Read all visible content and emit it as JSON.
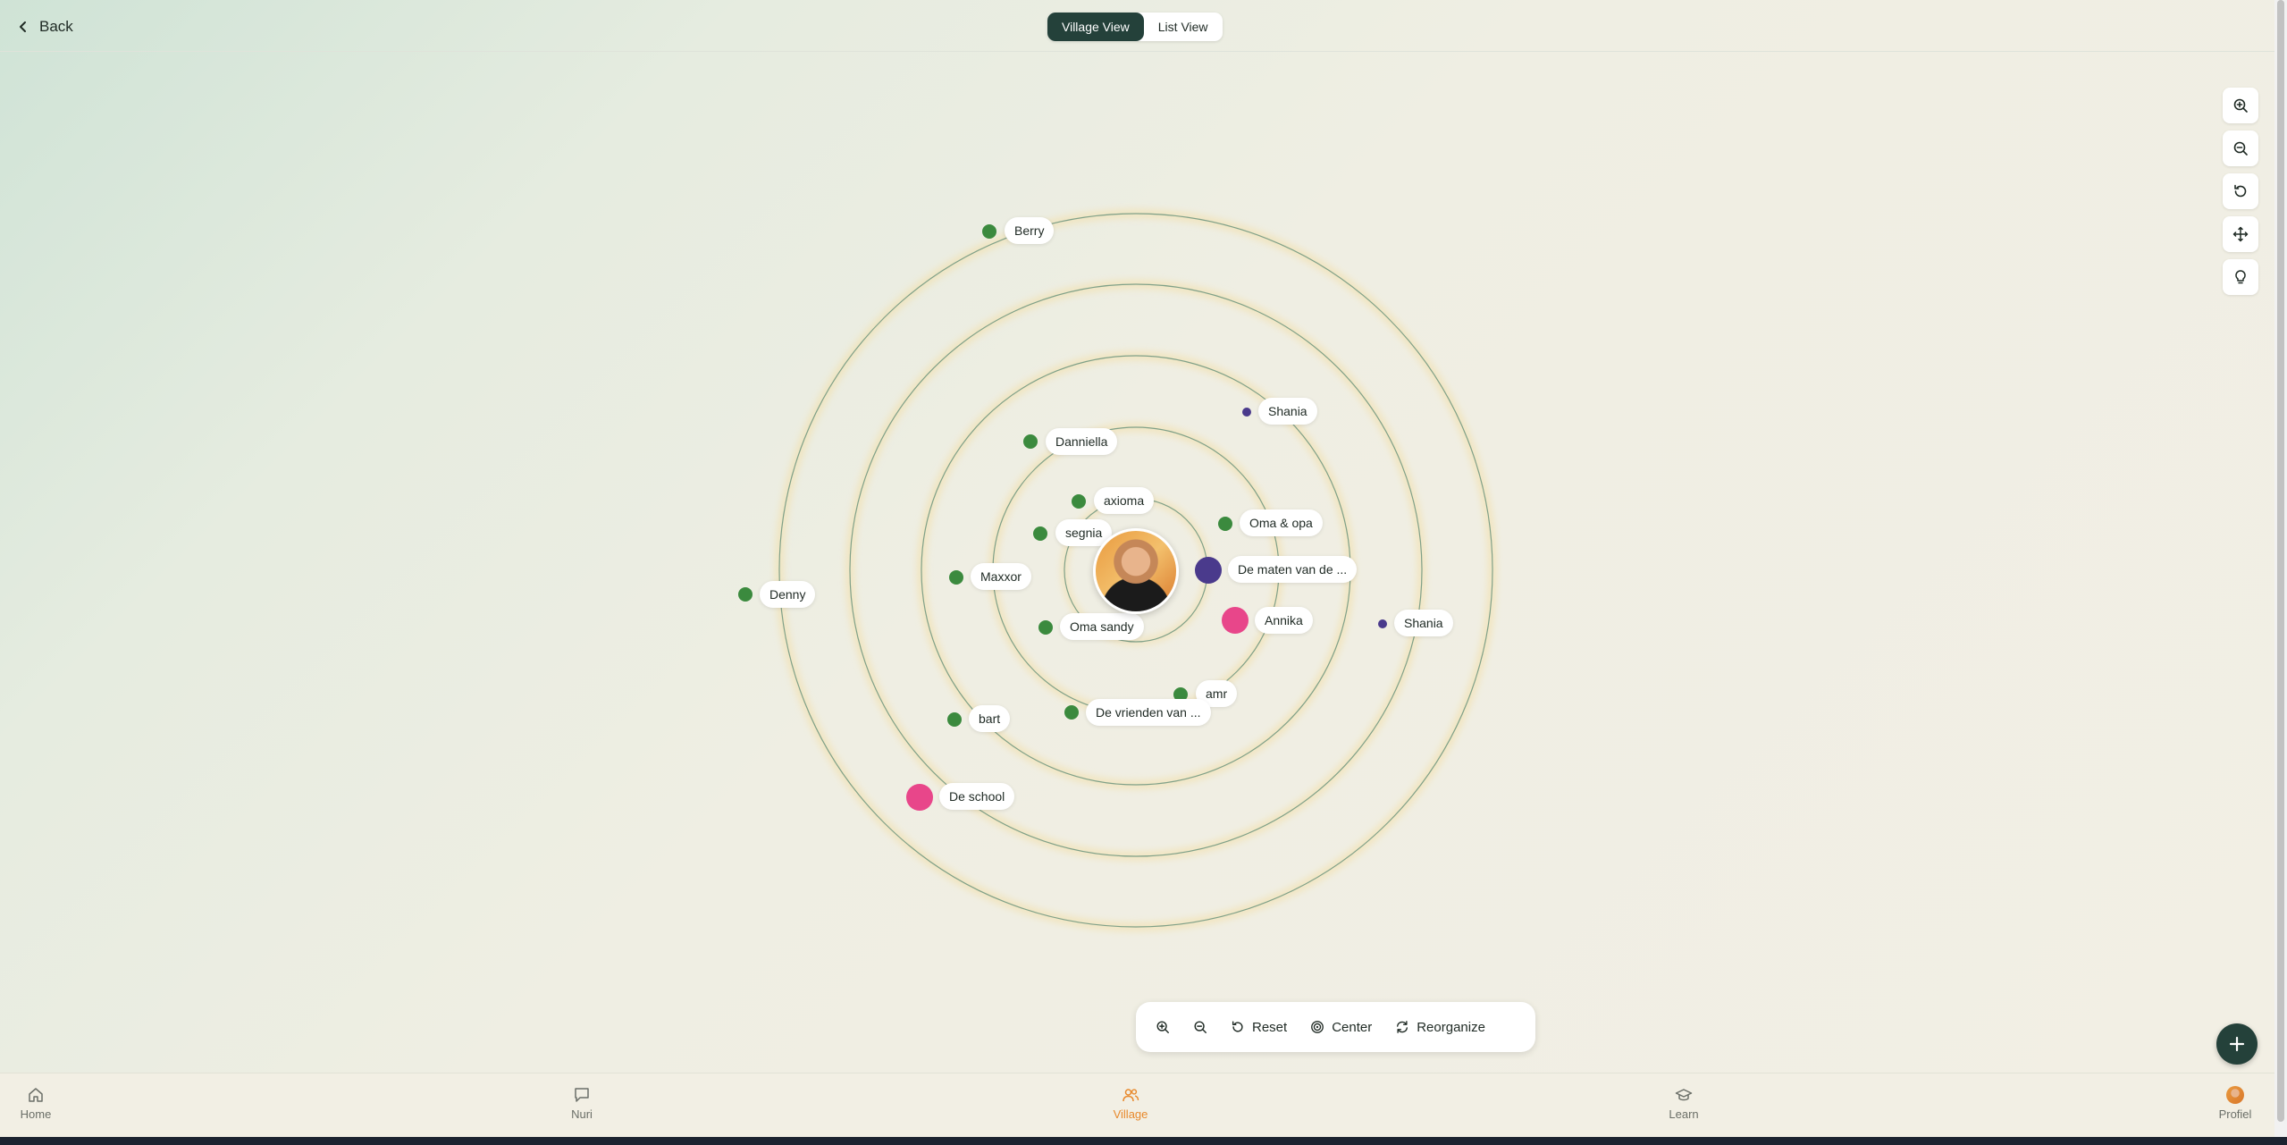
{
  "header": {
    "back_label": "Back",
    "view_toggle": [
      {
        "label": "Village View",
        "active": true
      },
      {
        "label": "List View",
        "active": false
      }
    ]
  },
  "right_tools": [
    {
      "name": "zoom-in",
      "icon": "zoom-in-icon"
    },
    {
      "name": "zoom-out",
      "icon": "zoom-out-icon"
    },
    {
      "name": "reset",
      "icon": "rotate-ccw-icon"
    },
    {
      "name": "move",
      "icon": "move-icon"
    },
    {
      "name": "tips",
      "icon": "lightbulb-icon"
    }
  ],
  "village": {
    "center_avatar": "user-avatar",
    "ring_count": 5,
    "colors": {
      "green": "#3b8a3e",
      "purple": "#4a3a8c",
      "pink": "#e8468a",
      "ring": "#7fa088"
    },
    "people": [
      {
        "name": "Berry",
        "color": "green"
      },
      {
        "name": "Shania",
        "color": "purple"
      },
      {
        "name": "Danniella",
        "color": "green"
      },
      {
        "name": "axioma",
        "color": "green"
      },
      {
        "name": "segnia",
        "color": "green"
      },
      {
        "name": "Oma & opa",
        "color": "green"
      },
      {
        "name": "De maten van de ...",
        "color": "purple"
      },
      {
        "name": "Maxxor",
        "color": "green"
      },
      {
        "name": "Denny",
        "color": "green"
      },
      {
        "name": "Oma sandy",
        "color": "green"
      },
      {
        "name": "Annika",
        "color": "pink"
      },
      {
        "name": "Shania",
        "color": "purple"
      },
      {
        "name": "amr",
        "color": "green"
      },
      {
        "name": "bart",
        "color": "green"
      },
      {
        "name": "De vrienden van ...",
        "color": "green"
      },
      {
        "name": "De school",
        "color": "pink"
      }
    ]
  },
  "toolbar": {
    "reset_label": "Reset",
    "center_label": "Center",
    "reorganize_label": "Reorganize"
  },
  "fab": {
    "icon": "plus-icon"
  },
  "nav": [
    {
      "label": "Home",
      "icon": "home-icon",
      "active": false
    },
    {
      "label": "Nuri",
      "icon": "chat-icon",
      "active": false
    },
    {
      "label": "Village",
      "icon": "users-icon",
      "active": true
    },
    {
      "label": "Learn",
      "icon": "graduation-cap-icon",
      "active": false
    },
    {
      "label": "Profiel",
      "icon": "profile-avatar",
      "active": false
    }
  ]
}
